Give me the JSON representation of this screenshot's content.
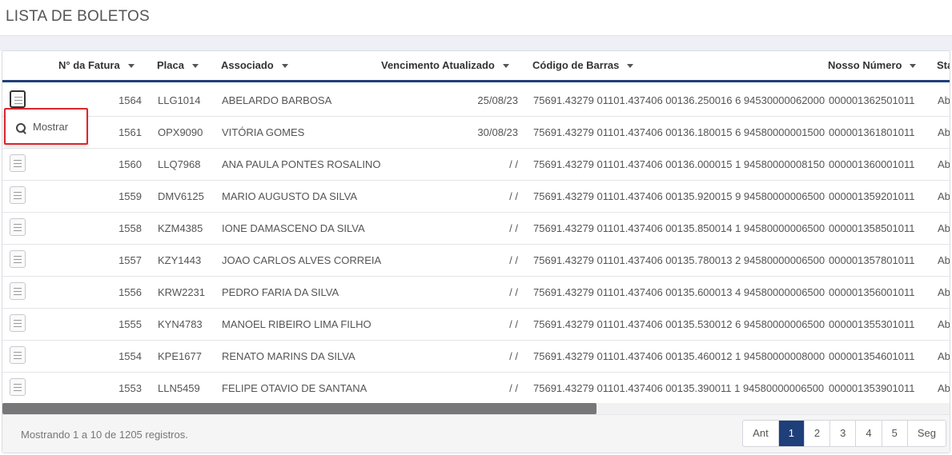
{
  "page": {
    "title": "LISTA DE BOLETOS"
  },
  "columns": [
    "N° da Fatura",
    "Placa",
    "Associado",
    "Vencimento Atualizado",
    "Código de Barras",
    "Nosso Número",
    "Sta"
  ],
  "dropdown": {
    "label": "Mostrar",
    "icon": "search-icon"
  },
  "rows": [
    {
      "num": "1564",
      "placa": "LLG1014",
      "assoc": "ABELARDO BARBOSA",
      "venc": "25/08/23",
      "cod": "75691.43279 01101.437406 00136.250016 6 94530000062000",
      "nosso": "000001362501011",
      "sta": "Ab"
    },
    {
      "num": "1561",
      "placa": "OPX9090",
      "assoc": "VITÓRIA GOMES",
      "venc": "30/08/23",
      "cod": "75691.43279 01101.437406 00136.180015 6 94580000001500",
      "nosso": "000001361801011",
      "sta": "Ab"
    },
    {
      "num": "1560",
      "placa": "LLQ7968",
      "assoc": "ANA PAULA PONTES ROSALINO",
      "venc": "/ /",
      "cod": "75691.43279 01101.437406 00136.000015 1 94580000008150",
      "nosso": "000001360001011",
      "sta": "Ab"
    },
    {
      "num": "1559",
      "placa": "DMV6125",
      "assoc": "MARIO AUGUSTO DA SILVA",
      "venc": "/ /",
      "cod": "75691.43279 01101.437406 00135.920015 9 94580000006500",
      "nosso": "000001359201011",
      "sta": "Ab"
    },
    {
      "num": "1558",
      "placa": "KZM4385",
      "assoc": "IONE DAMASCENO DA SILVA",
      "venc": "/ /",
      "cod": "75691.43279 01101.437406 00135.850014 1 94580000006500",
      "nosso": "000001358501011",
      "sta": "Ab"
    },
    {
      "num": "1557",
      "placa": "KZY1443",
      "assoc": "JOAO CARLOS ALVES CORREIA",
      "venc": "/ /",
      "cod": "75691.43279 01101.437406 00135.780013 2 94580000006500",
      "nosso": "000001357801011",
      "sta": "Ab"
    },
    {
      "num": "1556",
      "placa": "KRW2231",
      "assoc": "PEDRO FARIA DA SILVA",
      "venc": "/ /",
      "cod": "75691.43279 01101.437406 00135.600013 4 94580000006500",
      "nosso": "000001356001011",
      "sta": "Ab"
    },
    {
      "num": "1555",
      "placa": "KYN4783",
      "assoc": "MANOEL RIBEIRO LIMA FILHO",
      "venc": "/ /",
      "cod": "75691.43279 01101.437406 00135.530012 6 94580000006500",
      "nosso": "000001355301011",
      "sta": "Ab"
    },
    {
      "num": "1554",
      "placa": "KPE1677",
      "assoc": "RENATO MARINS DA SILVA",
      "venc": "/ /",
      "cod": "75691.43279 01101.437406 00135.460012 1 94580000008000",
      "nosso": "000001354601011",
      "sta": "Ab"
    },
    {
      "num": "1553",
      "placa": "LLN5459",
      "assoc": "FELIPE OTAVIO DE SANTANA",
      "venc": "/ /",
      "cod": "75691.43279 01101.437406 00135.390011 1 94580000006500",
      "nosso": "000001353901011",
      "sta": "Ab"
    }
  ],
  "footer": {
    "info": "Mostrando 1 a 10 de 1205 registros.",
    "pages": [
      "Ant",
      "1",
      "2",
      "3",
      "4",
      "5",
      "Seg"
    ],
    "active_page": "1"
  },
  "colors": {
    "accent": "#1f3f7a",
    "highlight": "#d9262c"
  }
}
